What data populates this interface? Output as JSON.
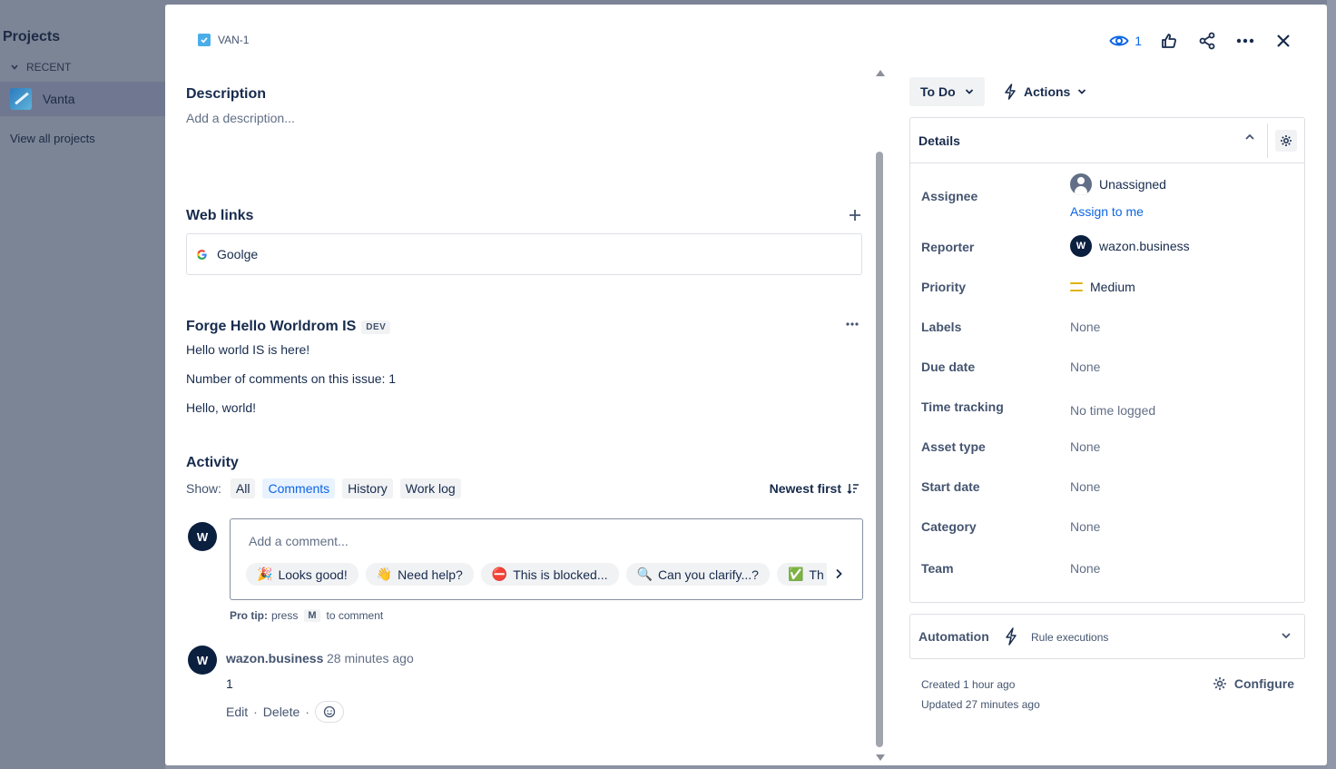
{
  "background": {
    "projects_title": "Projects",
    "recent_label": "RECENT",
    "project_name": "Vanta",
    "view_all": "View all projects"
  },
  "issue": {
    "key": "VAN-1",
    "watch_count": "1"
  },
  "description": {
    "title": "Description",
    "placeholder": "Add a description..."
  },
  "web_links": {
    "title": "Web links",
    "items": [
      {
        "label": "Goolge"
      }
    ]
  },
  "forge": {
    "title": "Forge Hello Worldrom IS",
    "badge": "DEV",
    "lines": [
      "Hello world IS is here!",
      "Number of comments on this issue: 1",
      "Hello, world!"
    ]
  },
  "activity": {
    "title": "Activity",
    "show_label": "Show:",
    "filters": [
      "All",
      "Comments",
      "History",
      "Work log"
    ],
    "active_filter": "Comments",
    "sort_label": "Newest first",
    "comment_placeholder": "Add a comment...",
    "quick_replies": [
      {
        "emoji": "🎉",
        "label": "Looks good!"
      },
      {
        "emoji": "👋",
        "label": "Need help?"
      },
      {
        "emoji": "⛔",
        "label": "This is blocked..."
      },
      {
        "emoji": "🔍",
        "label": "Can you clarify...?"
      },
      {
        "emoji": "✅",
        "label": "Th"
      }
    ],
    "protip_bold": "Pro tip:",
    "protip_press": "press",
    "protip_key": "M",
    "protip_rest": "to comment",
    "user_initial": "W",
    "comments": [
      {
        "author": "wazon.business",
        "time": "28 minutes ago",
        "body": "1",
        "edit": "Edit",
        "delete": "Delete"
      }
    ]
  },
  "sidebar": {
    "status": "To Do",
    "actions": "Actions",
    "details_title": "Details",
    "fields": {
      "assignee_label": "Assignee",
      "assignee_value": "Unassigned",
      "assign_link": "Assign to me",
      "reporter_label": "Reporter",
      "reporter_value": "wazon.business",
      "reporter_initial": "W",
      "priority_label": "Priority",
      "priority_value": "Medium",
      "labels_label": "Labels",
      "labels_value": "None",
      "due_label": "Due date",
      "due_value": "None",
      "time_label": "Time tracking",
      "time_value": "No time logged",
      "asset_label": "Asset type",
      "asset_value": "None",
      "start_label": "Start date",
      "start_value": "None",
      "category_label": "Category",
      "category_value": "None",
      "team_label": "Team",
      "team_value": "None"
    },
    "automation_title": "Automation",
    "rule_executions": "Rule executions",
    "created": "Created 1 hour ago",
    "updated": "Updated 27 minutes ago",
    "configure": "Configure"
  },
  "colors": {
    "accent": "#0c66e4",
    "priority_medium": "#e2b203",
    "avatar": "#0b1f3f"
  }
}
